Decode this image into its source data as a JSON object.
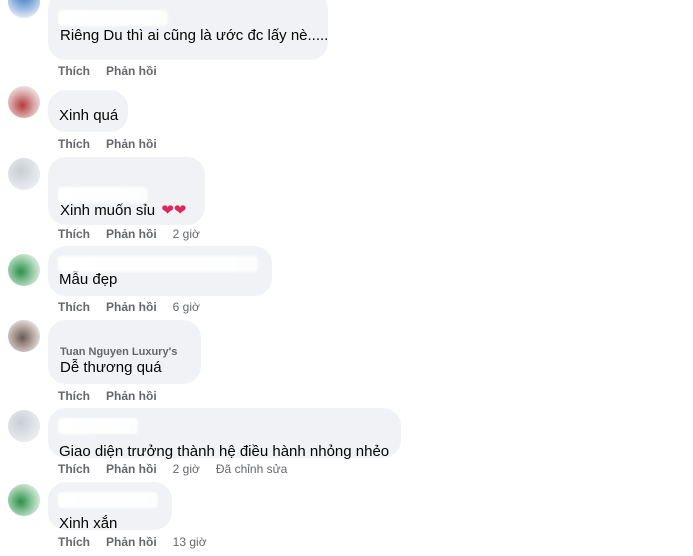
{
  "comments": [
    {
      "text": "Riêng Du thì ai cũng là ước đc lấy nè.....",
      "like": "Thích",
      "reply": "Phản hồi",
      "time": ""
    },
    {
      "text": "Xinh quá",
      "like": "Thích",
      "reply": "Phản hồi",
      "time": ""
    },
    {
      "text": "Xinh muốn sỉu",
      "hearts": "❤❤",
      "like": "Thích",
      "reply": "Phản hồi",
      "time": "2 giờ"
    },
    {
      "text": "Mẫu đẹp",
      "like": "Thích",
      "reply": "Phản hồi",
      "time": "6 giờ"
    },
    {
      "author": "Tuan Nguyen Luxury's",
      "text": "Dễ thương quá",
      "like": "Thích",
      "reply": "Phản hồi",
      "time": ""
    },
    {
      "text": "Giao diện trưởng thành hệ điều hành nhỏng nhẻo",
      "like": "Thích",
      "reply": "Phản hồi",
      "time": "2 giờ",
      "edited": "Đã chỉnh sửa"
    },
    {
      "text": "Xinh xắn",
      "like": "Thích",
      "reply": "Phản hồi",
      "time": "13 giờ"
    }
  ]
}
